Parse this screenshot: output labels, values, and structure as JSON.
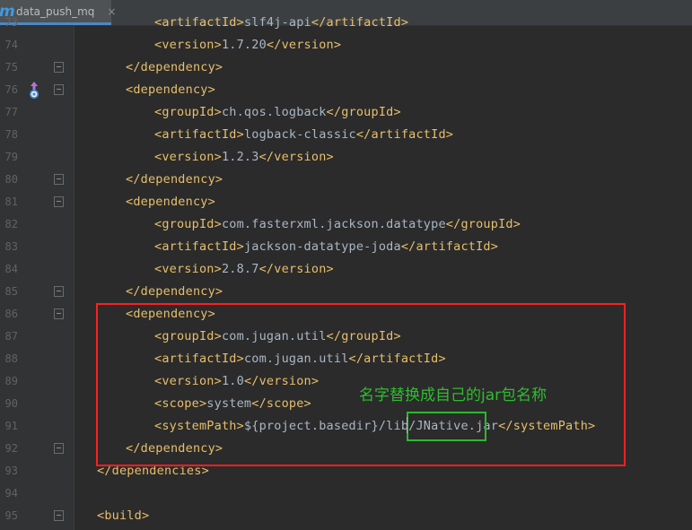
{
  "tab": {
    "icon": "maven-m-icon",
    "icon_char": "m",
    "label": "data_push_mq",
    "close": "×"
  },
  "colors": {
    "tag": "#e8bf6a",
    "text": "#a9b7c6",
    "annotation": "#2ebd2e",
    "red_box": "#ff1f1f",
    "green_box": "#2db82d"
  },
  "lines": [
    {
      "num": "73",
      "indent": 2,
      "open": "artifactId",
      "text": "slf4j-api",
      "close": "artifactId",
      "fold": false
    },
    {
      "num": "74",
      "indent": 2,
      "open": "version",
      "text": "1.7.20",
      "close": "version",
      "fold": false
    },
    {
      "num": "75",
      "indent": 1,
      "open": "",
      "text": "",
      "close": "dependency",
      "fold": true
    },
    {
      "num": "76",
      "indent": 1,
      "open": "dependency",
      "text": "",
      "close": "",
      "fold": true,
      "marker": "override-arrow-icon"
    },
    {
      "num": "77",
      "indent": 2,
      "open": "groupId",
      "text": "ch.qos.logback",
      "close": "groupId",
      "fold": false
    },
    {
      "num": "78",
      "indent": 2,
      "open": "artifactId",
      "text": "logback-classic",
      "close": "artifactId",
      "fold": false
    },
    {
      "num": "79",
      "indent": 2,
      "open": "version",
      "text": "1.2.3",
      "close": "version",
      "fold": false
    },
    {
      "num": "80",
      "indent": 1,
      "open": "",
      "text": "",
      "close": "dependency",
      "fold": true
    },
    {
      "num": "81",
      "indent": 1,
      "open": "dependency",
      "text": "",
      "close": "",
      "fold": true
    },
    {
      "num": "82",
      "indent": 2,
      "open": "groupId",
      "text": "com.fasterxml.jackson.datatype",
      "close": "groupId",
      "fold": false
    },
    {
      "num": "83",
      "indent": 2,
      "open": "artifactId",
      "text": "jackson-datatype-joda",
      "close": "artifactId",
      "fold": false
    },
    {
      "num": "84",
      "indent": 2,
      "open": "version",
      "text": "2.8.7",
      "close": "version",
      "fold": false
    },
    {
      "num": "85",
      "indent": 1,
      "open": "",
      "text": "",
      "close": "dependency",
      "fold": true
    },
    {
      "num": "86",
      "indent": 1,
      "open": "dependency",
      "text": "",
      "close": "",
      "fold": true
    },
    {
      "num": "87",
      "indent": 2,
      "open": "groupId",
      "text": "com.jugan.util",
      "close": "groupId",
      "fold": false
    },
    {
      "num": "88",
      "indent": 2,
      "open": "artifactId",
      "text": "com.jugan.util",
      "close": "artifactId",
      "fold": false
    },
    {
      "num": "89",
      "indent": 2,
      "open": "version",
      "text": "1.0",
      "close": "version",
      "fold": false
    },
    {
      "num": "90",
      "indent": 2,
      "open": "scope",
      "text": "system",
      "close": "scope",
      "fold": false
    },
    {
      "num": "91",
      "indent": 2,
      "open": "systemPath",
      "text": "${project.basedir}/lib/JNative.jar",
      "close": "systemPath",
      "fold": false
    },
    {
      "num": "92",
      "indent": 1,
      "open": "",
      "text": "",
      "close": "dependency",
      "fold": true
    },
    {
      "num": "93",
      "indent": 0,
      "open": "",
      "text": "",
      "close": "dependencies",
      "fold": false
    },
    {
      "num": "94",
      "indent": 0,
      "open": "",
      "text": "",
      "close": "",
      "fold": false
    },
    {
      "num": "95",
      "indent": 0,
      "open": "build",
      "text": "",
      "close": "",
      "fold": true
    }
  ],
  "annotation": "名字替换成自己的jar包名称"
}
